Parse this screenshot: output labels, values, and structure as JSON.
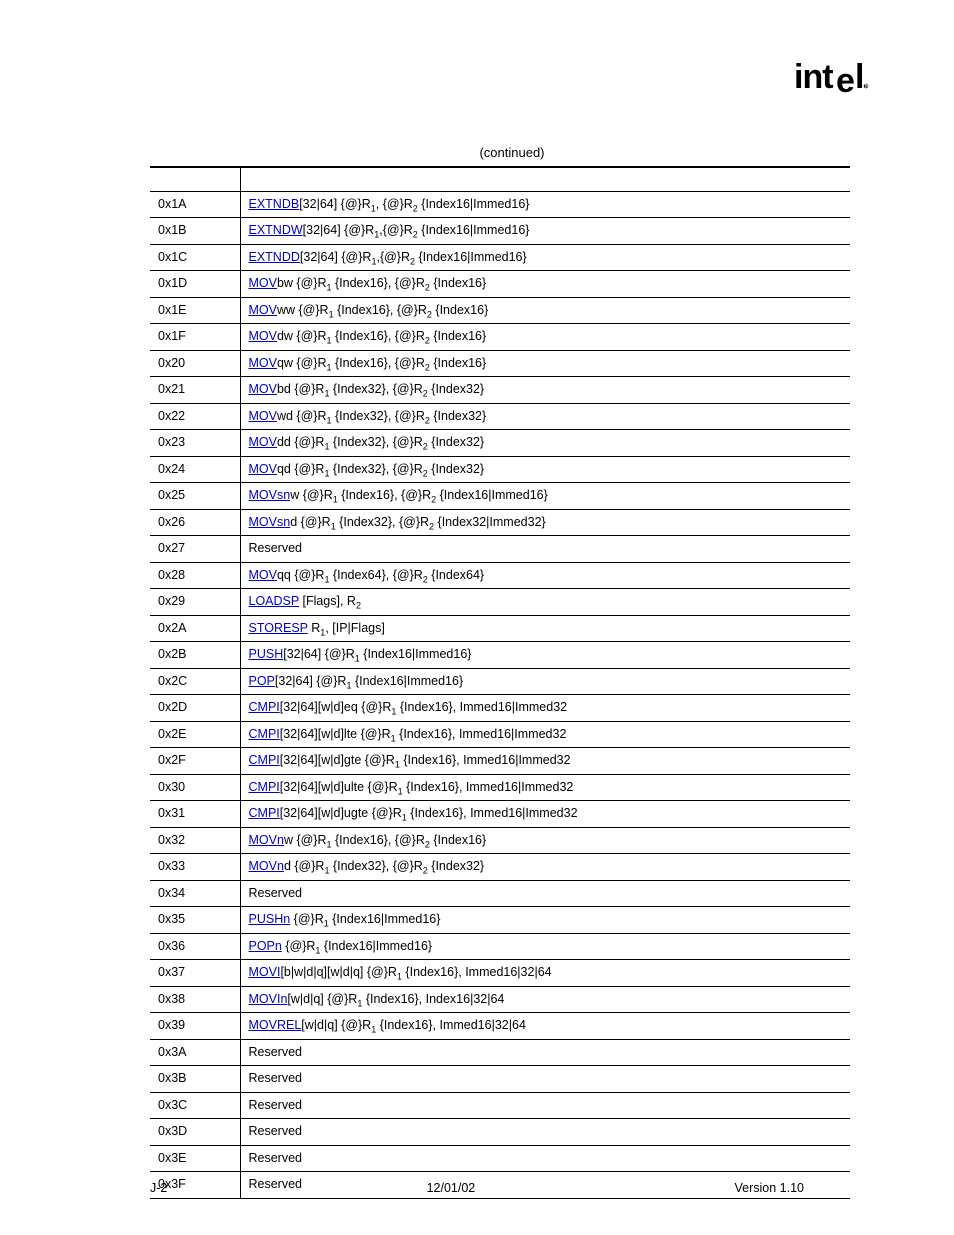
{
  "logo_text": "intel",
  "caption": "(continued)",
  "footer": {
    "left": "J-2",
    "center": "12/01/02",
    "right": "Version 1.10"
  },
  "rows": [
    {
      "op": "0x1A",
      "mnemonic": "EXTNDB",
      "rest": "[32|64]  {@}R₁, {@}R₂ {Index16|Immed16}"
    },
    {
      "op": "0x1B",
      "mnemonic": "EXTNDW",
      "rest": "[32|64] {@}R₁,{@}R₂ {Index16|Immed16}"
    },
    {
      "op": "0x1C",
      "mnemonic": "EXTNDD",
      "rest": "[32|64]  {@}R₁,{@}R₂ {Index16|Immed16}"
    },
    {
      "op": "0x1D",
      "mnemonic": "MOV",
      "suffix": "bw",
      "rest": " {@}R₁ {Index16}, {@}R₂ {Index16}"
    },
    {
      "op": "0x1E",
      "mnemonic": "MOV",
      "suffix": "ww",
      "rest": " {@}R₁ {Index16}, {@}R₂ {Index16}"
    },
    {
      "op": "0x1F",
      "mnemonic": "MOV",
      "suffix": "dw",
      "rest": " {@}R₁ {Index16}, {@}R₂ {Index16}"
    },
    {
      "op": "0x20",
      "mnemonic": "MOV",
      "suffix": "qw",
      "rest": " {@}R₁ {Index16}, {@}R₂ {Index16}"
    },
    {
      "op": "0x21",
      "mnemonic": "MOV",
      "suffix": "bd",
      "rest": " {@}R₁ {Index32}, {@}R₂ {Index32}"
    },
    {
      "op": "0x22",
      "mnemonic": "MOV",
      "suffix": "wd",
      "rest": " {@}R₁ {Index32}, {@}R₂ {Index32}"
    },
    {
      "op": "0x23",
      "mnemonic": "MOV",
      "suffix": "dd",
      "rest": " {@}R₁ {Index32}, {@}R₂ {Index32}"
    },
    {
      "op": "0x24",
      "mnemonic": "MOV",
      "suffix": "qd",
      "rest": " {@}R₁ {Index32}, {@}R₂ {Index32}"
    },
    {
      "op": "0x25",
      "mnemonic": "MOVsn",
      "suffix": "w",
      "rest": " {@}R₁ {Index16}, {@}R₂ {Index16|Immed16}"
    },
    {
      "op": "0x26",
      "mnemonic": "MOVsn",
      "suffix": "d",
      "rest": " {@}R₁ {Index32}, {@}R₂ {Index32|Immed32}"
    },
    {
      "op": "0x27",
      "reserved": "Reserved"
    },
    {
      "op": "0x28",
      "mnemonic": "MOV",
      "suffix": "qq",
      "rest": " {@}R₁ {Index64}, {@}R₂ {Index64}"
    },
    {
      "op": "0x29",
      "mnemonic": "LOADSP",
      "rest": "  [Flags], R₂"
    },
    {
      "op": "0x2A",
      "mnemonic": "STORESP",
      "rest": " R₁, [IP|Flags]"
    },
    {
      "op": "0x2B",
      "mnemonic": "PUSH",
      "rest": "[32|64] {@}R₁ {Index16|Immed16}"
    },
    {
      "op": "0x2C",
      "mnemonic": "POP",
      "rest": "[32|64] {@}R₁ {Index16|Immed16}"
    },
    {
      "op": "0x2D",
      "mnemonic": "CMPI",
      "rest": "[32|64][w|d]eq  {@}R₁ {Index16}, Immed16|Immed32"
    },
    {
      "op": "0x2E",
      "mnemonic": "CMPI",
      "rest": "[32|64][w|d]lte  {@}R₁ {Index16}, Immed16|Immed32"
    },
    {
      "op": "0x2F",
      "mnemonic": "CMPI",
      "rest": "[32|64][w|d]gte  {@}R₁ {Index16}, Immed16|Immed32"
    },
    {
      "op": "0x30",
      "mnemonic": "CMPI",
      "rest": "[32|64][w|d]ulte  {@}R₁ {Index16}, Immed16|Immed32"
    },
    {
      "op": "0x31",
      "mnemonic": "CMPI",
      "rest": "[32|64][w|d]ugte  {@}R₁ {Index16}, Immed16|Immed32"
    },
    {
      "op": "0x32",
      "mnemonic": "MOVn",
      "suffix": "w",
      "rest": " {@}R₁ {Index16}, {@}R₂ {Index16}"
    },
    {
      "op": "0x33",
      "mnemonic": "MOVn",
      "suffix": "d",
      "rest": " {@}R₁ {Index32}, {@}R₂ {Index32}"
    },
    {
      "op": "0x34",
      "reserved": "Reserved"
    },
    {
      "op": "0x35",
      "mnemonic": "PUSHn",
      "rest": " {@}R₁ {Index16|Immed16}"
    },
    {
      "op": "0x36",
      "mnemonic": "POPn",
      "rest": " {@}R₁ {Index16|Immed16}"
    },
    {
      "op": "0x37",
      "mnemonic": "MOVI",
      "rest": "[b|w|d|q][w|d|q] {@}R₁ {Index16}, Immed16|32|64"
    },
    {
      "op": "0x38",
      "mnemonic": "MOVIn",
      "rest": "[w|d|q] {@}R₁ {Index16}, Index16|32|64"
    },
    {
      "op": "0x39",
      "mnemonic": "MOVREL",
      "rest": "[w|d|q] {@}R₁ {Index16}, Immed16|32|64"
    },
    {
      "op": "0x3A",
      "reserved": "Reserved"
    },
    {
      "op": "0x3B",
      "reserved": "Reserved"
    },
    {
      "op": "0x3C",
      "reserved": "Reserved"
    },
    {
      "op": "0x3D",
      "reserved": "Reserved"
    },
    {
      "op": "0x3E",
      "reserved": "Reserved"
    },
    {
      "op": "0x3F",
      "reserved": "Reserved"
    }
  ]
}
